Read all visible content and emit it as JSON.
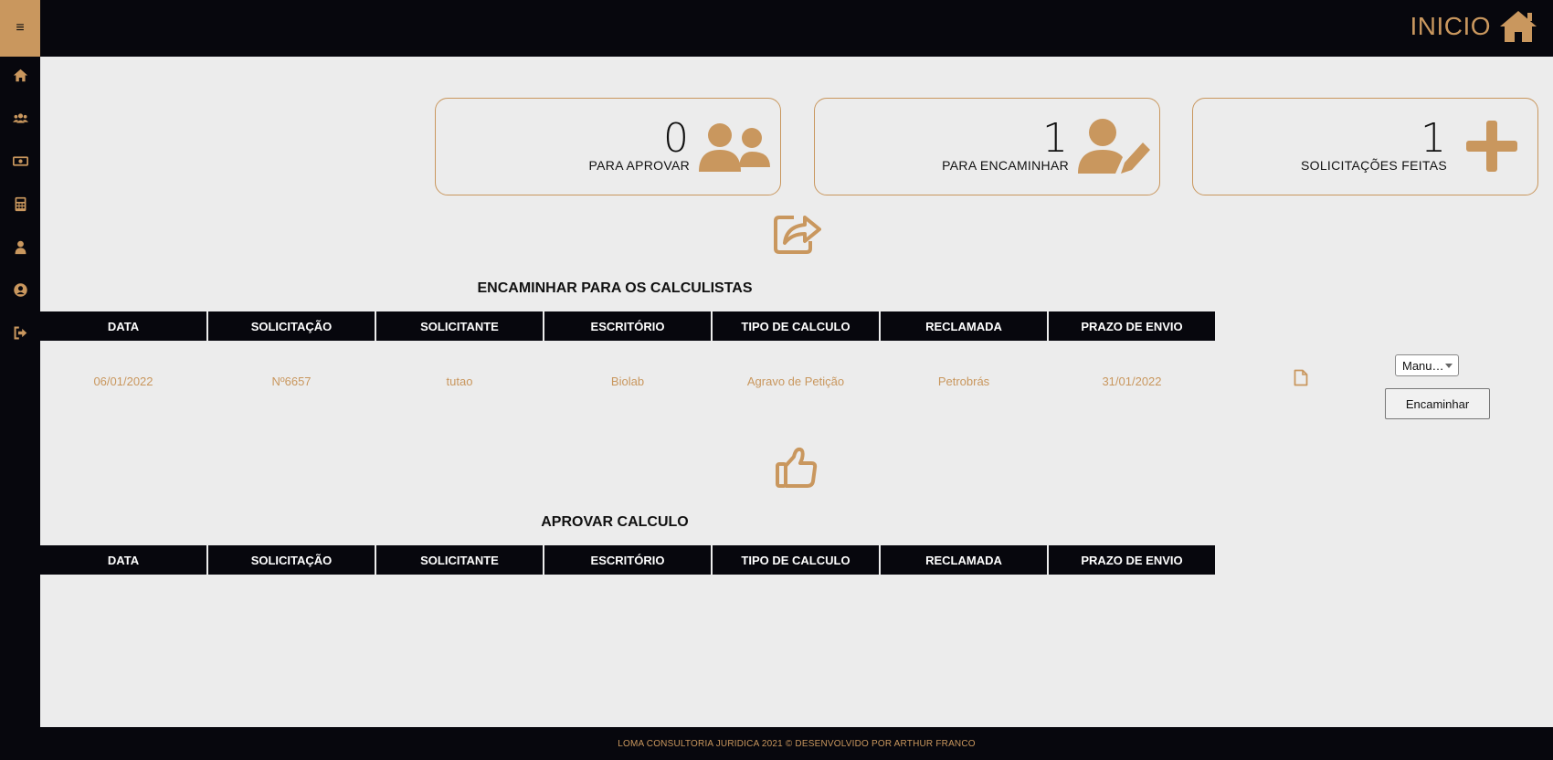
{
  "header": {
    "menu_icon": "≡",
    "title": "INICIO"
  },
  "sidebar": {
    "items": [
      {
        "name": "home-icon"
      },
      {
        "name": "users-icon"
      },
      {
        "name": "money-icon"
      },
      {
        "name": "calculator-icon"
      },
      {
        "name": "user-icon"
      },
      {
        "name": "user-circle-icon"
      },
      {
        "name": "sign-out-icon"
      }
    ]
  },
  "cards": [
    {
      "value": "0",
      "label": "PARA APROVAR",
      "icon": "users-icon"
    },
    {
      "value": "1",
      "label": "PARA ENCAMINHAR",
      "icon": "user-edit-icon"
    },
    {
      "value": "1",
      "label": "SOLICITAÇÕES FEITAS",
      "icon": "plus-icon"
    }
  ],
  "section_forward": {
    "title": "ENCAMINHAR PARA OS CALCULISTAS",
    "icon": "share-square-icon",
    "columns": [
      "DATA",
      "SOLICITAÇÃO",
      "SOLICITANTE",
      "ESCRITÓRIO",
      "TIPO DE CALCULO",
      "RECLAMADA",
      "PRAZO DE ENVIO"
    ],
    "rows": [
      {
        "cells": [
          "06/01/2022",
          "Nº6657",
          "tutao",
          "Biolab",
          "Agravo de Petição",
          "Petrobrás",
          "31/01/2022"
        ],
        "select_value": "Manu…",
        "action_label": "Encaminhar"
      }
    ]
  },
  "section_approve": {
    "title": "APROVAR CALCULO",
    "icon": "thumbs-up-icon",
    "columns": [
      "DATA",
      "SOLICITAÇÃO",
      "SOLICITANTE",
      "ESCRITÓRIO",
      "TIPO DE CALCULO",
      "RECLAMADA",
      "PRAZO DE ENVIO"
    ]
  },
  "footer": {
    "text": "LOMA CONSULTORIA JURIDICA 2021 © DESENVOLVIDO POR ARTHUR FRANCO"
  },
  "colors": {
    "accent": "#c9975e",
    "dark": "#07070d",
    "background": "#ececec"
  }
}
